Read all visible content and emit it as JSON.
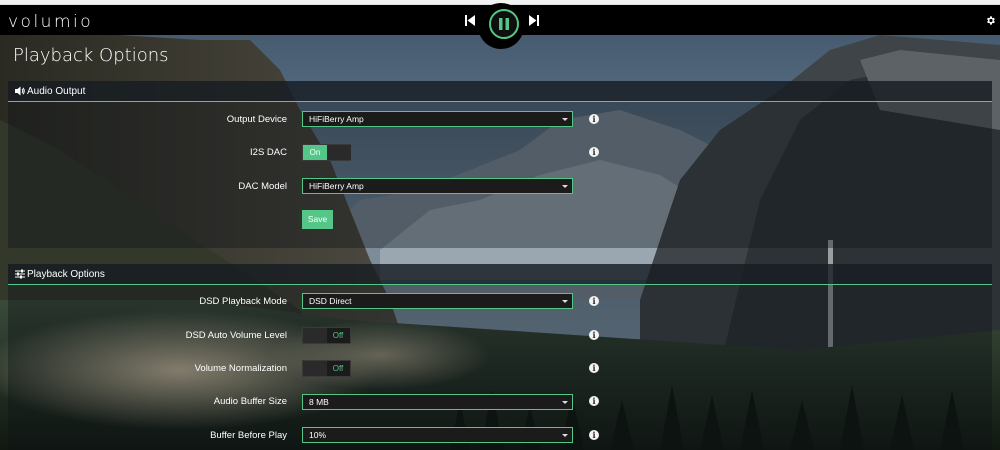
{
  "app": {
    "logo": "volumio"
  },
  "player": {
    "prev_icon": "skip-previous-icon",
    "play_pause_icon": "pause-icon",
    "next_icon": "skip-next-icon",
    "settings_icon": "gear-icon",
    "accent": "#54c688"
  },
  "page": {
    "title": "Playback Options"
  },
  "audio_output": {
    "header": "Audio Output",
    "header_icon": "speaker-icon",
    "output_device": {
      "label": "Output Device",
      "value": "HiFiBerry Amp"
    },
    "i2s_dac": {
      "label": "I2S DAC",
      "state": "On"
    },
    "dac_model": {
      "label": "DAC Model",
      "value": "HiFiBerry Amp"
    },
    "save_label": "Save"
  },
  "playback_options": {
    "header": "Playback Options",
    "header_icon": "sliders-icon",
    "dsd_mode": {
      "label": "DSD Playback Mode",
      "value": "DSD Direct"
    },
    "dsd_auto_volume": {
      "label": "DSD Auto Volume Level",
      "state": "Off"
    },
    "volume_normalization": {
      "label": "Volume Normalization",
      "state": "Off"
    },
    "audio_buffer_size": {
      "label": "Audio Buffer Size",
      "value": "8 MB"
    },
    "buffer_before_play": {
      "label": "Buffer Before Play",
      "value": "10%"
    }
  }
}
